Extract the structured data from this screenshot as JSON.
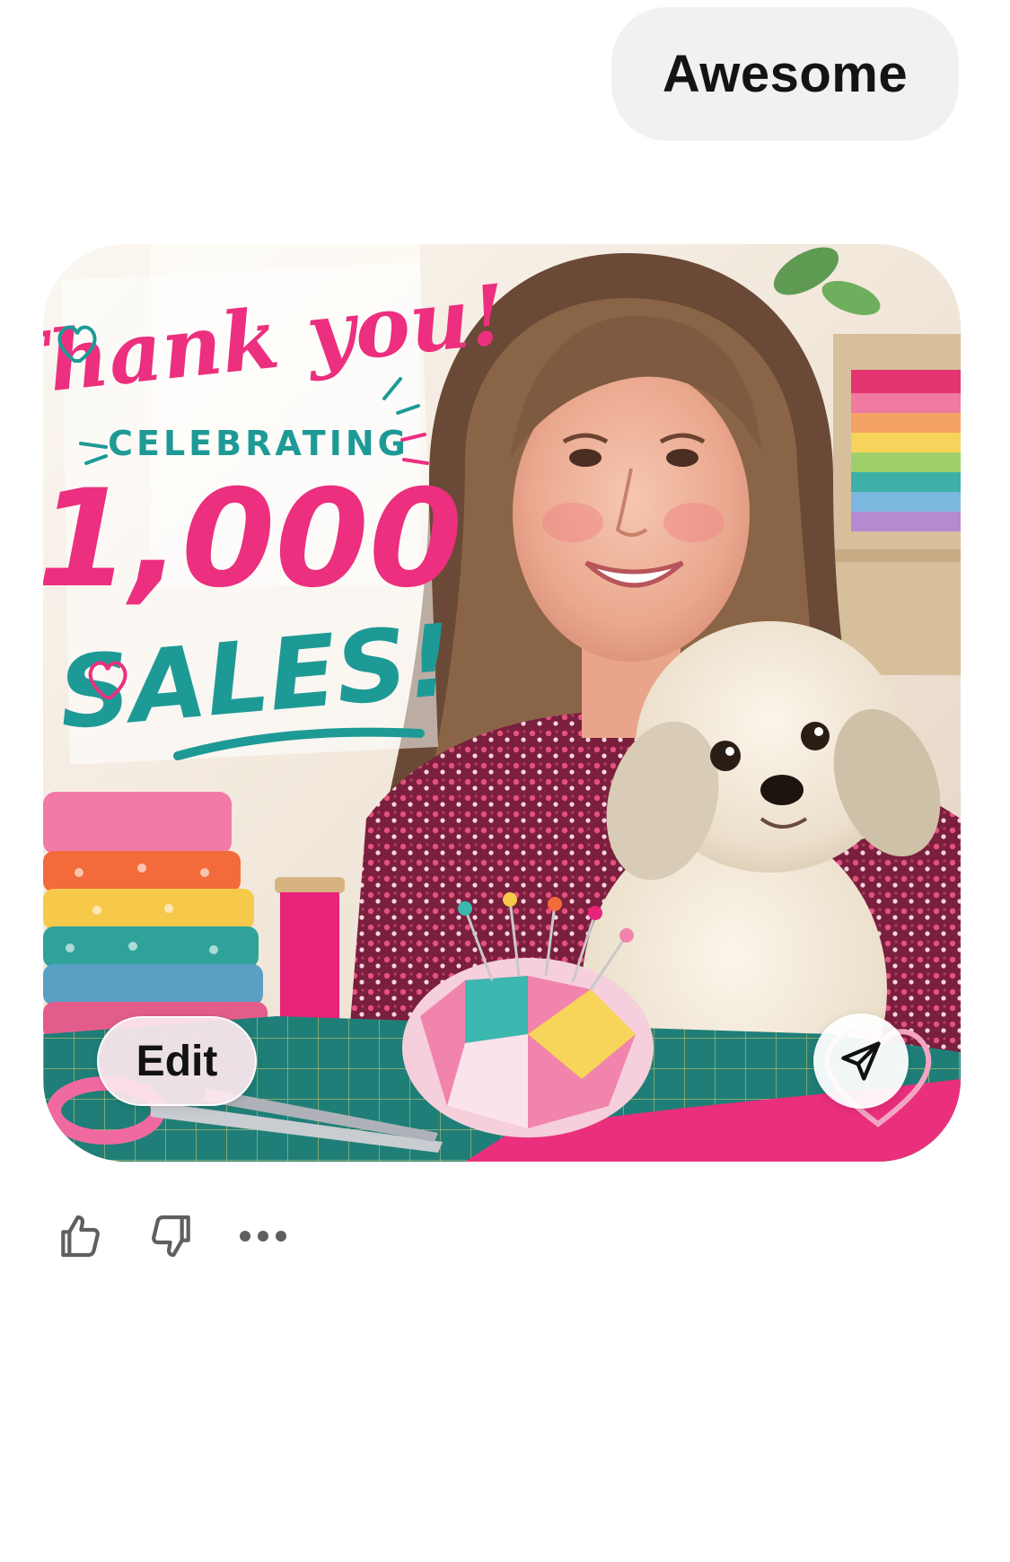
{
  "message": {
    "user_text": "Awesome"
  },
  "generated_image": {
    "headline": "Thank you!",
    "subhead": "CELEBRATING",
    "number": "1,000",
    "word": "SALES!",
    "colors": {
      "pink": "#ec2f7e",
      "teal": "#1e9a96"
    }
  },
  "image_overlay": {
    "edit_label": "Edit",
    "share_icon": "send-icon"
  },
  "feedback": {
    "like_icon": "thumbs-up-icon",
    "dislike_icon": "thumbs-down-icon",
    "more_icon": "more-icon"
  }
}
